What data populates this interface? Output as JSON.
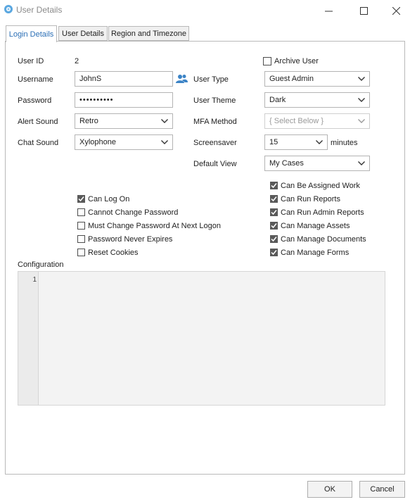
{
  "window": {
    "title": "User Details"
  },
  "tabs": [
    {
      "label": "Login Details",
      "active": true
    },
    {
      "label": "User Details",
      "active": false
    },
    {
      "label": "Region and Timezone",
      "active": false
    }
  ],
  "form": {
    "user_id_label": "User ID",
    "user_id_value": "2",
    "username_label": "Username",
    "username_value": "JohnS",
    "password_label": "Password",
    "password_value": "••••••••••",
    "alert_sound_label": "Alert Sound",
    "alert_sound_value": "Retro",
    "chat_sound_label": "Chat Sound",
    "chat_sound_value": "Xylophone",
    "archive_user_label": "Archive User",
    "user_type_label": "User Type",
    "user_type_value": "Guest Admin",
    "user_theme_label": "User Theme",
    "user_theme_value": "Dark",
    "mfa_method_label": "MFA Method",
    "mfa_method_value": "{ Select Below }",
    "screensaver_label": "Screensaver",
    "screensaver_value": "15",
    "screensaver_unit": "minutes",
    "default_view_label": "Default View",
    "default_view_value": "My Cases"
  },
  "left_checkboxes": [
    {
      "label": "Can Log On",
      "checked": true
    },
    {
      "label": "Cannot Change Password",
      "checked": false
    },
    {
      "label": "Must Change Password At Next Logon",
      "checked": false
    },
    {
      "label": "Password Never Expires",
      "checked": false
    },
    {
      "label": "Reset Cookies",
      "checked": false
    }
  ],
  "right_checkboxes": [
    {
      "label": "Can Be Assigned Work",
      "checked": true
    },
    {
      "label": "Can Run Reports",
      "checked": true
    },
    {
      "label": "Can Run Admin Reports",
      "checked": true
    },
    {
      "label": "Can Manage Assets",
      "checked": true
    },
    {
      "label": "Can Manage Documents",
      "checked": true
    },
    {
      "label": "Can Manage Forms",
      "checked": true
    }
  ],
  "configuration": {
    "label": "Configuration",
    "line_number": "1"
  },
  "buttons": {
    "ok": "OK",
    "cancel": "Cancel"
  },
  "colors": {
    "accent": "#2b6fb6",
    "tab_active_text": "#2b6fb6",
    "icon_blue": "#3b83c6"
  }
}
